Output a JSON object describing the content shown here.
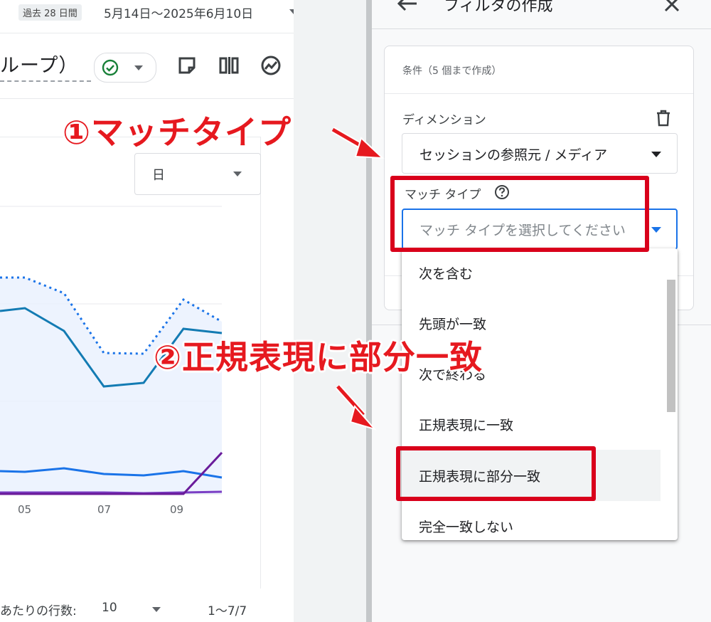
{
  "report": {
    "date_chip": "過去 28 日間",
    "date_range": "5月14日～2025年6月10日",
    "title_fragment": "ループ）",
    "time_granularity": "日",
    "x_ticks": [
      "05",
      "07",
      "09"
    ],
    "rows_per_page_label": "あたりの行数:",
    "rows_per_page_value": "10",
    "pagination": "1～7/7"
  },
  "panel": {
    "title": "フィルタの作成",
    "conditions_header": "条件（5 個まで作成）",
    "dimension_label": "ディメンション",
    "dimension_value": "セッションの参照元 / メディア",
    "match_type_label": "マッチ タイプ",
    "match_type_placeholder": "マッチ タイプを選択してください",
    "options": [
      "次を含む",
      "先頭が一致",
      "次で終わる",
      "正規表現に一致",
      "正規表現に部分一致",
      "完全一致しない"
    ]
  },
  "annotations": {
    "step1": "①マッチタイプ",
    "step2": "②正規表現に部分一致"
  },
  "colors": {
    "accent_blue": "#1a73e8",
    "annotation_red": "#e6191f",
    "success_green": "#188038"
  },
  "icons": [
    "back-arrow-icon",
    "close-icon",
    "check-circle-icon",
    "note-icon",
    "compare-icon",
    "insights-icon",
    "share-icon",
    "sparkle-icon",
    "trash-icon",
    "help-icon",
    "dropdown-arrow-icon"
  ]
}
